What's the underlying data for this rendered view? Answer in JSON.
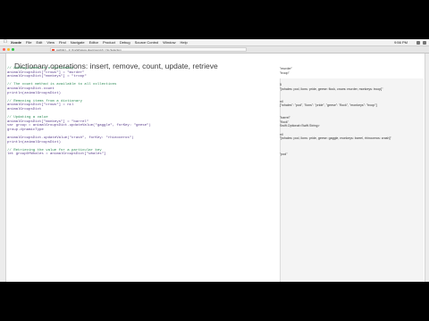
{
  "menubar": {
    "apple_glyph": "",
    "menus": [
      "Xcode",
      "File",
      "Edit",
      "View",
      "Find",
      "Navigate",
      "Editor",
      "Product",
      "Debug",
      "Source Control",
      "Window",
      "Help"
    ],
    "clock": "9:56 PM"
  },
  "window": {
    "tab_title": "swiftdict - 1) OneWireless.playground.rb | No Selection",
    "traffic_lights": [
      "#ff5f57",
      "#febc2e",
      "#28c840"
    ]
  },
  "playground": {
    "title": "Dictionary operations: insert, remove, count, update, retrieve",
    "code_lines": [
      {
        "kind": "comment",
        "text": "// Adding items to a dictionary"
      },
      {
        "kind": "code",
        "text": "animalGroupsDict[\"crows\"] = \"murder\""
      },
      {
        "kind": "code",
        "text": "animalGroupsDict[\"monkeys\"] = \"troop\""
      },
      {
        "kind": "blank",
        "text": " "
      },
      {
        "kind": "comment",
        "text": "// The count method is available to all collections"
      },
      {
        "kind": "code",
        "text": "animalGroupsDict.count"
      },
      {
        "kind": "code",
        "text": "println(animalGroupsDict)"
      },
      {
        "kind": "blank",
        "text": " "
      },
      {
        "kind": "comment",
        "text": "// Removing items from a dictionary"
      },
      {
        "kind": "code",
        "text": "animalGroupsDict[\"crows\"] = nil"
      },
      {
        "kind": "code",
        "text": "animalGroupsDict"
      },
      {
        "kind": "blank",
        "text": " "
      },
      {
        "kind": "comment",
        "text": "// Updating a value"
      },
      {
        "kind": "code",
        "text": "animalGroupsDict[\"monkeys\"] = \"barrel\""
      },
      {
        "kind": "code",
        "text": "var group = animalGroupsDict.updateValue(\"gaggle\", forKey: \"geese\")"
      },
      {
        "kind": "code",
        "text": "group.dynamicType"
      },
      {
        "kind": "blank",
        "text": " "
      },
      {
        "kind": "code",
        "text": "animalGroupsDict.updateValue(\"crash\", forKey: \"rhinoceros\")"
      },
      {
        "kind": "code",
        "text": "println(animalGroupsDict)"
      },
      {
        "kind": "blank",
        "text": " "
      },
      {
        "kind": "comment",
        "text": "// Retrieving the value for a particular key"
      },
      {
        "kind": "code",
        "text": "let groupOfWhales = animalGroupsDict[\"whales\"]"
      }
    ],
    "result_lines": [
      "\"murder\"",
      "\"troop\"",
      " ",
      " ",
      "5",
      "\"[whales: pod, lions: pride, geese: flock, crows: murder, monkeys: troop]\"",
      " ",
      " ",
      "nil",
      "[\"whales\": \"pod\", \"lions\": \"pride\", \"geese\": \"flock\", \"monkeys\": \"troop\"]",
      " ",
      " ",
      "\"barrel\"",
      "\"flock\"",
      "Swift.Optional<Swift.String>",
      " ",
      "nil",
      "\"[whales: pod, lions: pride, geese: gaggle, monkeys: barrel, rhinoceros: crash]\"",
      " ",
      " ",
      " ",
      "\"pod\""
    ]
  }
}
